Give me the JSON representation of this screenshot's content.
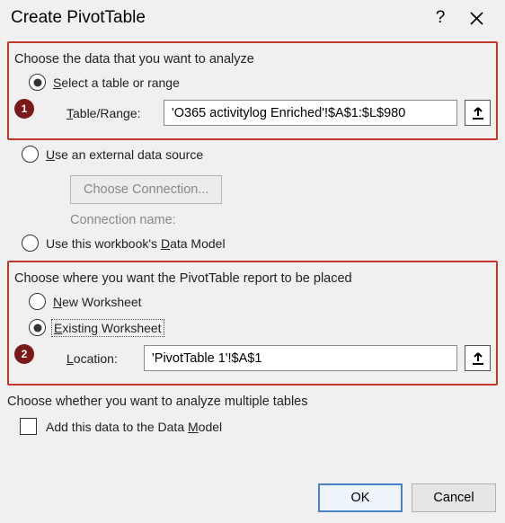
{
  "title": "Create PivotTable",
  "section1": {
    "heading": "Choose the data that you want to analyze",
    "badge": "1",
    "opt_select": {
      "prefix": "S",
      "rest": "elect a table or range",
      "checked": true
    },
    "table_range_label": {
      "prefix": "T",
      "rest": "able/Range:"
    },
    "table_range_value": "'O365 activitylog Enriched'!$A$1:$L$980",
    "opt_external": {
      "prefix": "U",
      "rest": "se an external data source",
      "checked": false
    },
    "choose_connection_label": "Choose Connection...",
    "connection_name_label": "Connection name:",
    "opt_datamodel": {
      "pre": "Use this workbook's ",
      "u": "D",
      "post": "ata Model",
      "checked": false
    }
  },
  "section2": {
    "heading": "Choose where you want the PivotTable report to be placed",
    "badge": "2",
    "opt_new": {
      "prefix": "N",
      "rest": "ew Worksheet",
      "checked": false
    },
    "opt_existing": {
      "prefix": "E",
      "rest": "xisting Worksheet",
      "checked": true
    },
    "location_label": {
      "prefix": "L",
      "rest": "ocation:"
    },
    "location_value": "'PivotTable 1'!$A$1"
  },
  "section3": {
    "heading": "Choose whether you want to analyze multiple tables",
    "checkbox": {
      "pre": "Add this data to the Data ",
      "u": "M",
      "post": "odel",
      "checked": false
    }
  },
  "buttons": {
    "ok": "OK",
    "cancel": "Cancel"
  }
}
